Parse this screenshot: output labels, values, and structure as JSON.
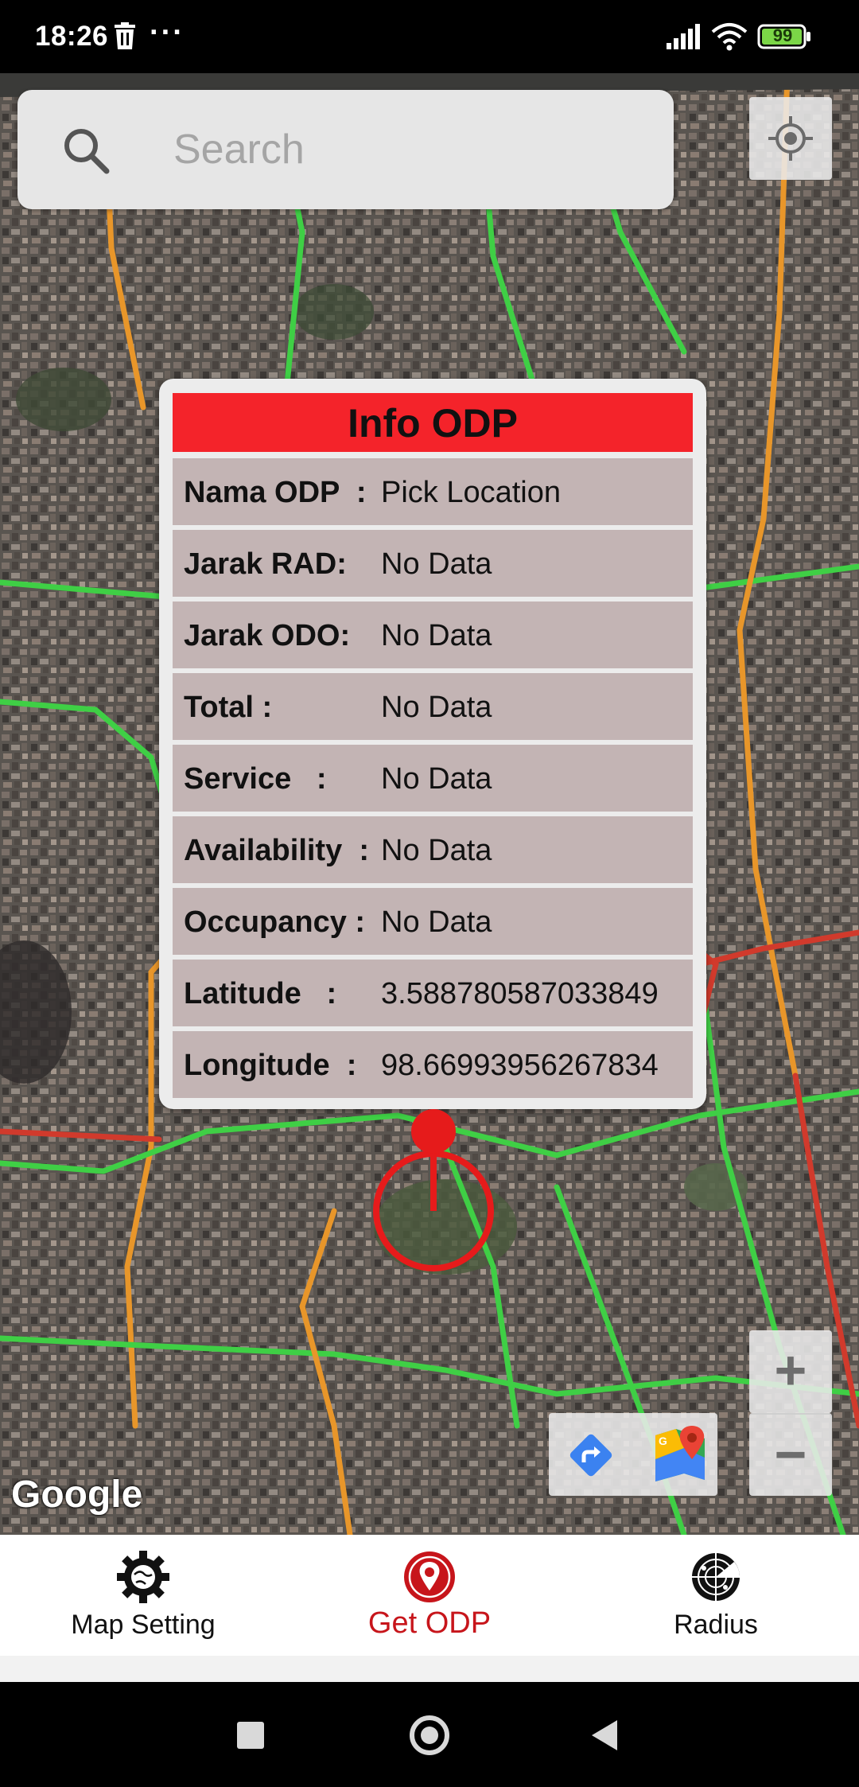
{
  "status_bar": {
    "time": "18:26",
    "battery": "99",
    "icons": [
      "trash-icon",
      "more-dots-icon",
      "signal-icon",
      "wifi-icon",
      "battery-icon"
    ]
  },
  "search": {
    "placeholder": "Search",
    "icon": "search-icon"
  },
  "info_card": {
    "title": "Info ODP",
    "title_color": "#f4232a",
    "rows": [
      {
        "label": "Nama ODP  :",
        "value": "Pick Location"
      },
      {
        "label": "Jarak RAD:",
        "value": "No Data"
      },
      {
        "label": "Jarak ODO:",
        "value": "No Data"
      },
      {
        "label": "Total :",
        "value": "No Data"
      },
      {
        "label": "Service   :",
        "value": "No Data"
      },
      {
        "label": "Availability  :",
        "value": "No Data"
      },
      {
        "label": "Occupancy :",
        "value": "No Data"
      },
      {
        "label": "Latitude   :",
        "value": "3.588780587033849"
      },
      {
        "label": "Longitude  :",
        "value": "98.66993956267834"
      }
    ]
  },
  "map": {
    "attribution": "Google",
    "zoom_in": "+",
    "zoom_out": "−",
    "controls": [
      "locate-icon",
      "directions-icon",
      "google-maps-icon"
    ]
  },
  "bottom_nav": {
    "active_color": "#c7151b",
    "items": [
      {
        "label": "Map Setting",
        "icon": "gear-globe-icon"
      },
      {
        "label": "Get ODP",
        "icon": "location-pin-icon"
      },
      {
        "label": "Radius",
        "icon": "radar-icon"
      }
    ]
  }
}
